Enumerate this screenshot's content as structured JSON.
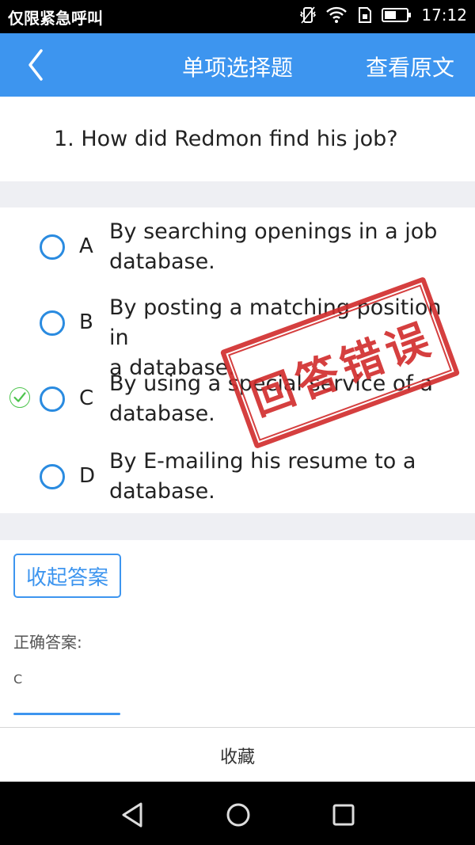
{
  "status_bar": {
    "carrier_text": "仅限紧急呼叫",
    "time": "17:12",
    "icons": [
      "vibrate-icon",
      "wifi-icon",
      "sim-icon",
      "battery-icon"
    ]
  },
  "header": {
    "title": "单项选择题",
    "right_action": "查看原文",
    "back_icon": "chevron-left-icon",
    "bg_color": "#3d95ef"
  },
  "question": {
    "text": "1. How did Redmon find his job?"
  },
  "options": [
    {
      "letter": "A",
      "line1": "By searching openings in a job",
      "line2": "database.",
      "marked_correct": false
    },
    {
      "letter": "B",
      "line1": "By posting a matching position in",
      "line2": "a database.",
      "marked_correct": false
    },
    {
      "letter": "C",
      "line1": "By using a special service of a",
      "line2": "database.",
      "marked_correct": true
    },
    {
      "letter": "D",
      "line1": "By E-mailing his resume to a",
      "line2": "database.",
      "marked_correct": false
    }
  ],
  "stamp": {
    "text": "回答错误",
    "color": "#d12b2b"
  },
  "answer": {
    "collapse_label": "收起答案",
    "correct_label": "正确答案:",
    "correct_value": "C"
  },
  "bottom_bar": {
    "favorite_label": "收藏"
  },
  "nav_bar": {
    "icons": [
      "back-triangle-icon",
      "home-circle-icon",
      "recents-square-icon"
    ]
  }
}
